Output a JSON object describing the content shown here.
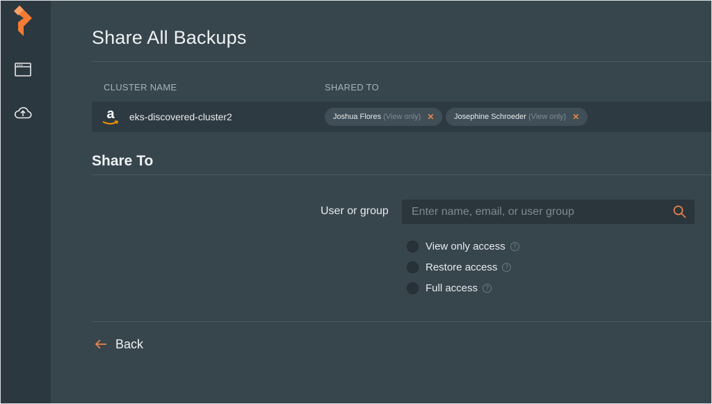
{
  "page": {
    "title": "Share All Backups",
    "section_title": "Share To"
  },
  "sidebar": {
    "logo": "portworx-logo",
    "items": [
      {
        "icon": "window-icon"
      },
      {
        "icon": "cloud-upload-icon"
      }
    ]
  },
  "table": {
    "columns": [
      "CLUSTER NAME",
      "SHARED TO"
    ],
    "rows": [
      {
        "provider_label": "a",
        "cluster_name": "eks-discovered-cluster2",
        "shared_to": [
          {
            "name": "Joshua Flores",
            "access": "(View only)",
            "remove": "✕"
          },
          {
            "name": "Josephine Schroeder",
            "access": "(View only)",
            "remove": "✕"
          }
        ]
      }
    ]
  },
  "share_form": {
    "label": "User or group",
    "placeholder": "Enter name, email, or user group",
    "value": "",
    "options": [
      {
        "label": "View only access",
        "help": "?",
        "selected": false
      },
      {
        "label": "Restore access",
        "help": "?",
        "selected": false
      },
      {
        "label": "Full access",
        "help": "?",
        "selected": false
      }
    ]
  },
  "back": {
    "label": "Back"
  },
  "colors": {
    "background": "#37454d",
    "sidebar": "#2c383f",
    "accent": "#e8834a",
    "row": "#2e3a41",
    "chip": "#3f4e57"
  }
}
